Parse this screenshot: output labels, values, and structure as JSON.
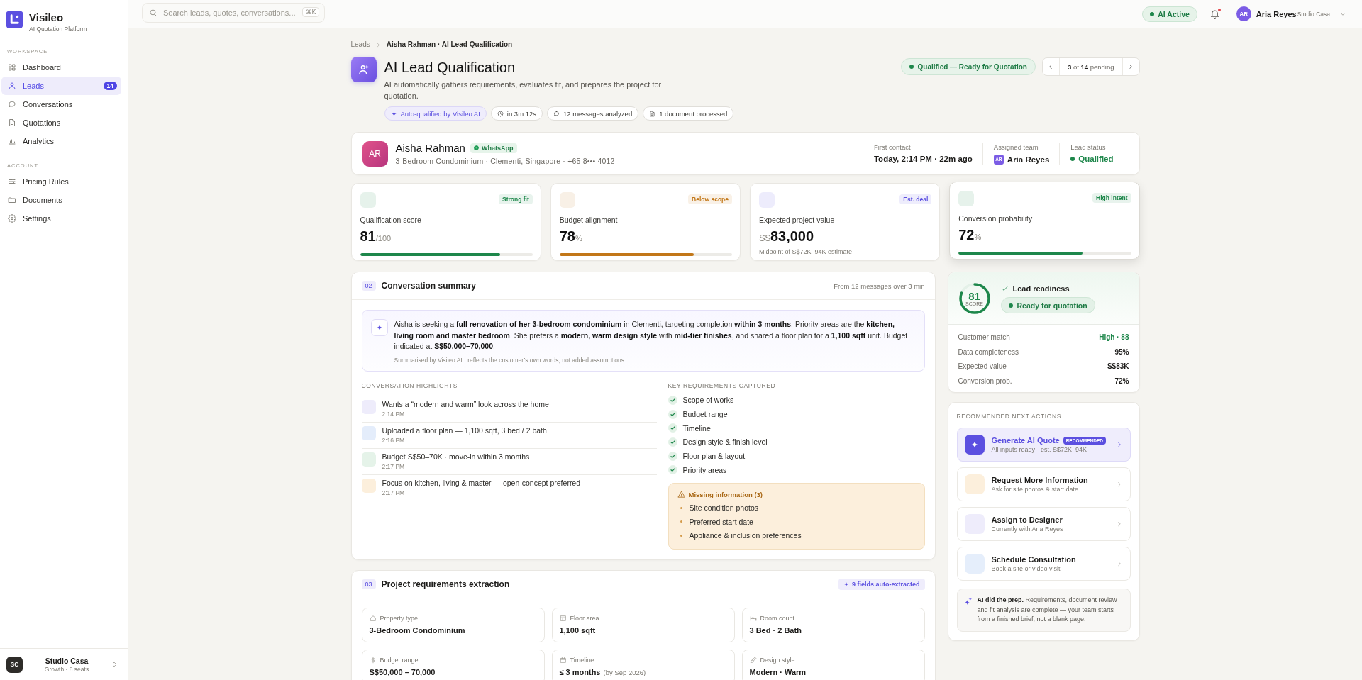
{
  "sidebar": {
    "brand": {
      "name": "Visileo",
      "tagline": "AI Quotation Platform"
    },
    "sections": [
      {
        "title": "WORKSPACE",
        "items": [
          {
            "label": "Dashboard",
            "selected": false
          },
          {
            "label": "Leads",
            "selected": true,
            "count": "14"
          },
          {
            "label": "Conversations",
            "selected": false
          },
          {
            "label": "Quotations",
            "selected": false
          },
          {
            "label": "Analytics",
            "selected": false
          }
        ]
      },
      {
        "title": "ACCOUNT",
        "items": [
          {
            "label": "Pricing Rules",
            "selected": false
          },
          {
            "label": "Documents",
            "selected": false
          },
          {
            "label": "Settings",
            "selected": false
          }
        ]
      }
    ],
    "workspace": {
      "initials": "SC",
      "name": "Studio Casa",
      "plan": "Growth · 8 seats"
    }
  },
  "top_bar": {
    "search": {
      "placeholder": "Search leads, quotes, conversations...",
      "shortcut": "⌘K"
    },
    "ai_status": {
      "label": "AI Active",
      "on": true
    },
    "notifications": {
      "unread": true
    },
    "user": {
      "initials": "AR",
      "name": "Aria Reyes",
      "org": "Studio Casa"
    }
  },
  "breadcrumbs": [
    "Leads",
    "Aisha Rahman · AI Lead Qualification"
  ],
  "header": {
    "title": "AI Lead Qualification",
    "subtitle": "AI automatically gathers requirements, evaluates fit, and prepares the project for quotation.",
    "chips": [
      {
        "kind": "ai",
        "text": "Auto-qualified by Visileo AI"
      },
      {
        "kind": "time",
        "text": "in 3m 12s"
      },
      {
        "kind": "messages",
        "text": "12 messages analyzed"
      },
      {
        "kind": "document",
        "text": "1 document processed"
      }
    ],
    "status": "Qualified — Ready for Quotation",
    "pager": "**3** of **14** pending"
  },
  "lead": {
    "initials": "AR",
    "name": "Aisha Rahman",
    "channel": "WhatsApp",
    "details": "3-Bedroom Condominium · Clementi, Singapore · +65 8••• 4012",
    "facts": [
      {
        "kind": "text",
        "label": "First contact",
        "value": "Today, 2:14 PM · 22m ago"
      },
      {
        "kind": "person",
        "label": "Assigned team",
        "initials": "AR",
        "value": "Aria Reyes"
      },
      {
        "kind": "status",
        "label": "Lead status",
        "value": "Qualified"
      }
    ]
  },
  "metrics": [
    {
      "label": "Qualification score",
      "badge": "Strong fit",
      "color": "#1e874b",
      "value": "81",
      "suffix": "/100",
      "level": 0.81,
      "hovered": false
    },
    {
      "label": "Budget alignment",
      "badge": "Below scope",
      "color": "#c27718",
      "value": "78",
      "suffix": "%",
      "level": 0.78,
      "hovered": false
    },
    {
      "label": "Expected project value",
      "badge": "Est. deal",
      "color": "#5b4fe0",
      "prefix": "S$",
      "value": "83,000",
      "note": "Midpoint of S$72K–94K estimate",
      "hovered": false
    },
    {
      "label": "Conversion probability",
      "badge": "High intent",
      "color": "#1e874b",
      "value": "72",
      "suffix": "%",
      "level": 0.72,
      "hovered": true
    }
  ],
  "conversation_summary": {
    "number": "02",
    "title": "Conversation summary",
    "meta": "From 12 messages over 3 min",
    "summary": "Aisha is seeking a **full renovation of her 3-bedroom condominium** in Clementi, targeting completion **within 3 months**. Priority areas are the **kitchen, living room and master bedroom**. She prefers a **modern, warm design style** with **mid-tier finishes**, and shared a floor plan for a **1,100 sqft** unit. Budget indicated at **S$50,000–70,000**.",
    "caption": "Summarised by Visileo AI · reflects the customer’s own words, not added assumptions",
    "highlights": {
      "title": "CONVERSATION HIGHLIGHTS",
      "items": [
        {
          "text": "Wants a “modern and warm” look across the home",
          "time": "2:14 PM",
          "color": "#eeecfb"
        },
        {
          "text": "Uploaded a floor plan — 1,100 sqft, 3 bed / 2 bath",
          "time": "2:16 PM",
          "color": "#e4edfb"
        },
        {
          "text": "Budget S$50–70K · move-in within 3 months",
          "time": "2:17 PM",
          "color": "#e5f3e9"
        },
        {
          "text": "Focus on kitchen, living & master — open-concept preferred",
          "time": "2:17 PM",
          "color": "#fcefdc"
        }
      ]
    },
    "requirements": {
      "title": "KEY REQUIREMENTS CAPTURED",
      "items": [
        {
          "text": "Scope of works",
          "checked": true
        },
        {
          "text": "Budget range",
          "checked": true
        },
        {
          "text": "Timeline",
          "checked": true
        },
        {
          "text": "Design style & finish level",
          "checked": true
        },
        {
          "text": "Floor plan & layout",
          "checked": true
        },
        {
          "text": "Priority areas",
          "checked": true
        }
      ]
    },
    "missing": {
      "title": "Missing information (3)",
      "items": [
        "Site condition photos",
        "Preferred start date",
        "Appliance & inclusion preferences"
      ]
    }
  },
  "project_requirements": {
    "number": "03",
    "title": "Project requirements extraction",
    "badge": "9 fields auto-extracted",
    "fields": [
      {
        "label": "Property type",
        "value": "3-Bedroom Condominium"
      },
      {
        "label": "Floor area",
        "value": "1,100 sqft"
      },
      {
        "label": "Room count",
        "value": "3 Bed · 2 Bath"
      },
      {
        "label": "Budget range",
        "value": "S$50,000 – 70,000"
      },
      {
        "label": "Timeline",
        "value": "≤ 3 months",
        "note": "(by Sep 2026)"
      },
      {
        "label": "Design style",
        "value": "Modern · Warm"
      }
    ]
  },
  "readiness": {
    "score": "81",
    "score_label": "SCORE",
    "title": "Lead readiness",
    "status": "Ready for quotation",
    "stats": [
      {
        "label": "Customer match",
        "value": "High · 88",
        "kind": "positive"
      },
      {
        "label": "Data completeness",
        "value": "95%",
        "kind": "plain"
      },
      {
        "label": "Expected value",
        "value": "S$83K",
        "kind": "plain"
      },
      {
        "label": "Conversion prob.",
        "value": "72%",
        "kind": "plain"
      }
    ]
  },
  "next_actions": {
    "title": "RECOMMENDED NEXT ACTIONS",
    "actions": [
      {
        "title": "Generate AI Quote",
        "badge": "RECOMMENDED",
        "subtitle": "All inputs ready · est. S$72K–94K",
        "selected": true,
        "color": "#5b4fe0"
      },
      {
        "title": "Request More Information",
        "subtitle": "Ask for site photos & start date",
        "selected": false,
        "color": "#fcefdc"
      },
      {
        "title": "Assign to Designer",
        "subtitle": "Currently with Aria Reyes",
        "selected": false,
        "color": "#eeecfb"
      },
      {
        "title": "Schedule Consultation",
        "subtitle": "Book a site or video visit",
        "selected": false,
        "color": "#e5eefb"
      }
    ],
    "note": "**AI did the prep.** Requirements, document review and fit analysis are complete — your team starts from a finished brief, not a blank page."
  }
}
